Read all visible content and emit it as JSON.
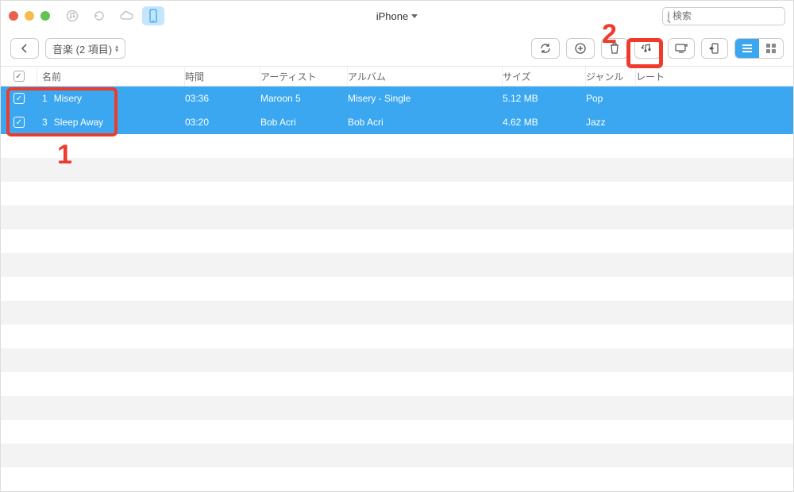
{
  "window": {
    "title": "iPhone",
    "traffic_colors": {
      "close": "#ec5f4e",
      "min": "#f5bd4f",
      "max": "#61c454"
    }
  },
  "search": {
    "placeholder": "検索"
  },
  "toolbar": {
    "category_label": "音楽 (2 項目)"
  },
  "columns": {
    "name": "名前",
    "time": "時間",
    "artist": "アーティスト",
    "album": "アルバム",
    "size": "サイズ",
    "genre": "ジャンル",
    "rate": "レート"
  },
  "tracks": [
    {
      "index": "1",
      "name": "Misery",
      "time": "03:36",
      "artist": "Maroon 5",
      "album": "Misery - Single",
      "size": "5.12 MB",
      "genre": "Pop",
      "checked": true
    },
    {
      "index": "3",
      "name": "Sleep Away",
      "time": "03:20",
      "artist": "Bob Acri",
      "album": "Bob Acri",
      "size": "4.62 MB",
      "genre": "Jazz",
      "checked": true
    }
  ],
  "empty_row_count": 15,
  "callouts": {
    "one": "1",
    "two": "2"
  },
  "colors": {
    "accent": "#3aa7f0",
    "annotation": "#ef3b2c"
  }
}
